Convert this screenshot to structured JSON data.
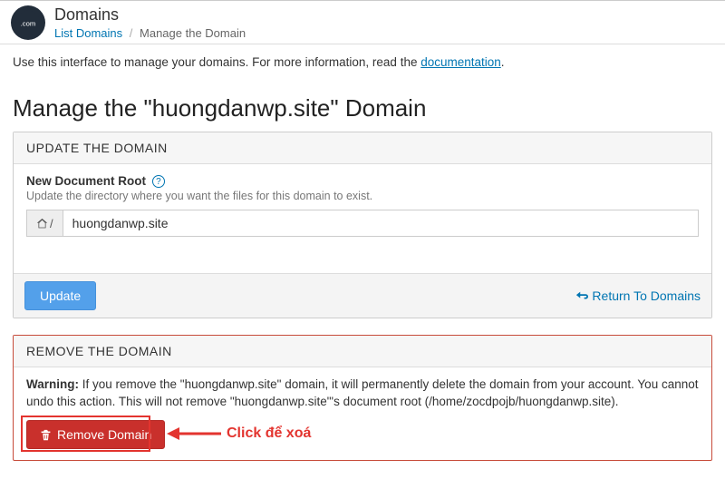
{
  "header": {
    "logo_text": ".com",
    "title": "Domains",
    "breadcrumb": {
      "list_link": "List Domains",
      "current": "Manage the Domain"
    }
  },
  "intro": {
    "text_before": "Use this interface to manage your domains. For more information, read the ",
    "link_text": "documentation",
    "text_after": "."
  },
  "page_title": "Manage the \"huongdanwp.site\" Domain",
  "update_panel": {
    "header": "UPDATE THE DOMAIN",
    "field_label": "New Document Root",
    "field_help": "Update the directory where you want the files for this domain to exist.",
    "addon_text": "/",
    "input_value": "huongdanwp.site",
    "update_button": "Update",
    "return_link": "Return To Domains"
  },
  "remove_panel": {
    "header": "REMOVE THE DOMAIN",
    "warning_label": "Warning:",
    "warning_text": " If you remove the \"huongdanwp.site\" domain, it will permanently delete the domain from your account. You cannot undo this action. This will not remove \"huongdanwp.site\"'s document root (/home/zocdpojb/huongdanwp.site).",
    "remove_button": "Remove Domain"
  },
  "annotation": {
    "text": "Click để xoá"
  }
}
